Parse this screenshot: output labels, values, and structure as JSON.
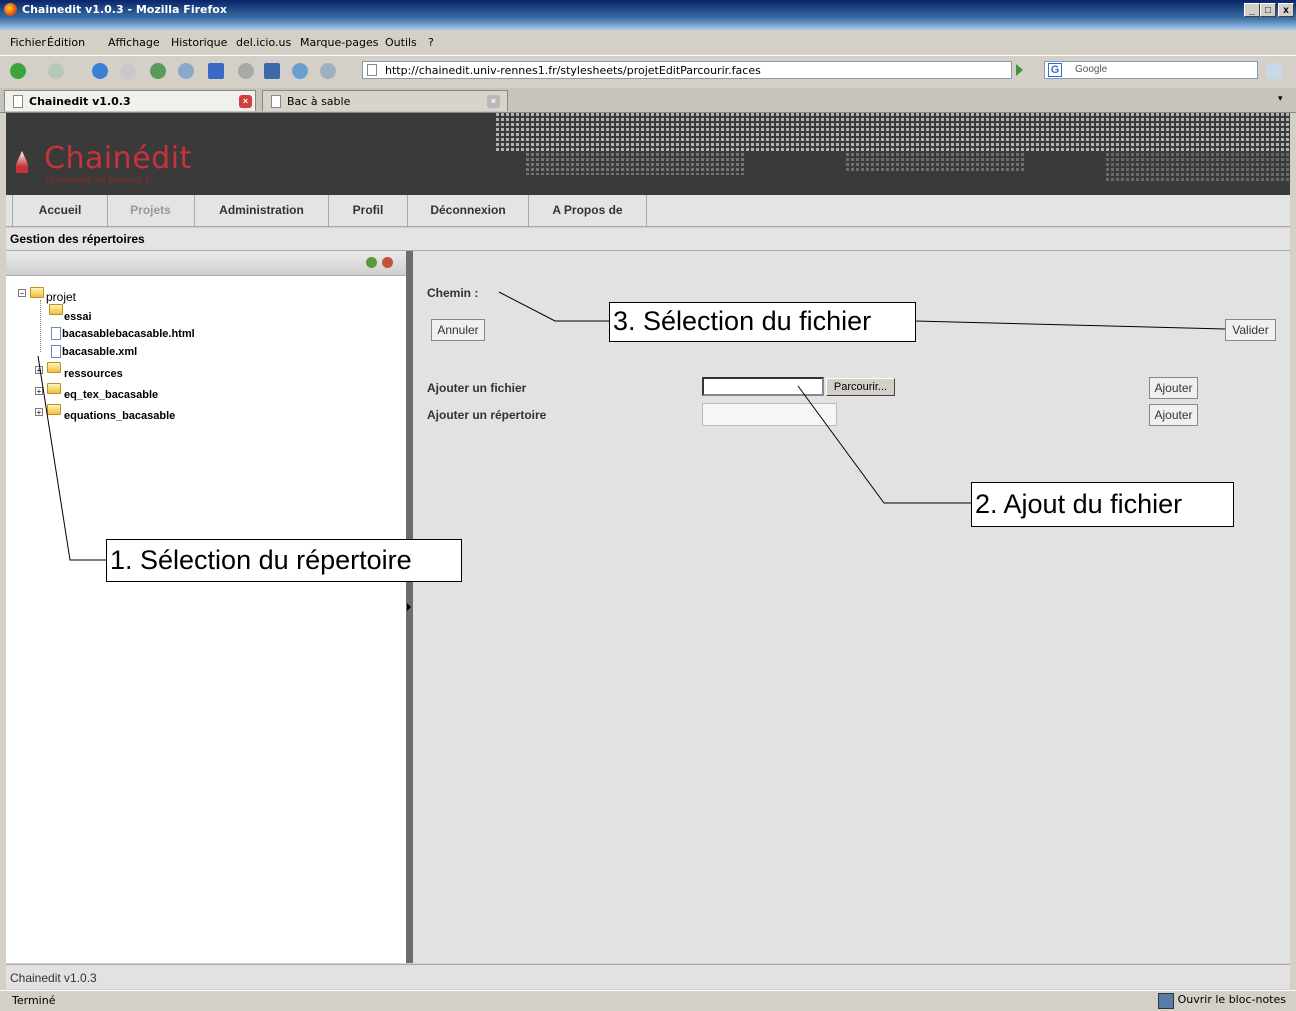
{
  "window": {
    "title": "Chainedit v1.0.3 - Mozilla Firefox",
    "min": "_",
    "max": "□",
    "close": "x"
  },
  "menu": [
    "Fichier",
    "Édition",
    "Affichage",
    "Historique",
    "del.icio.us",
    "Marque-pages",
    "Outils",
    "?"
  ],
  "toolbar": {
    "url": "http://chainedit.univ-rennes1.fr/stylesheets/projetEditParcourir.faces",
    "search_placeholder": "Google"
  },
  "tabs": [
    {
      "label": "Chainedit v1.0.3",
      "active": true
    },
    {
      "label": "Bac à sable",
      "active": false
    }
  ],
  "banner": {
    "logo": "Chainédit",
    "subtitle": "Université de Rennes 1"
  },
  "nav": [
    "Accueil",
    "Projets",
    "Administration",
    "Profil",
    "Déconnexion",
    "A Propos de"
  ],
  "section_title": "Gestion des répertoires",
  "tree": {
    "root": "projet",
    "items": [
      {
        "label": "essai",
        "type": "folder"
      },
      {
        "label": "bacasablebacasable.html",
        "type": "file"
      },
      {
        "label": "bacasable.xml",
        "type": "file"
      },
      {
        "label": "ressources",
        "type": "folder"
      },
      {
        "label": "eq_tex_bacasable",
        "type": "folder"
      },
      {
        "label": "equations_bacasable",
        "type": "folder"
      }
    ]
  },
  "form": {
    "chemin_label": "Chemin :",
    "annuler": "Annuler",
    "valider": "Valider",
    "add_file_label": "Ajouter un fichier",
    "add_dir_label": "Ajouter un répertoire",
    "browse": "Parcourir...",
    "ajouter_file": "Ajouter",
    "ajouter_dir": "Ajouter"
  },
  "callouts": {
    "c1": "1. Sélection du répertoire",
    "c2": "2. Ajout du fichier",
    "c3": "3. Sélection du fichier"
  },
  "footer": "Chainedit v1.0.3",
  "status": {
    "left": "Terminé",
    "right": "Ouvrir le bloc-notes"
  },
  "colors": {
    "logo": "#c8323a",
    "banner_bg": "#3a3a3a",
    "titlebar": "#0a246a"
  }
}
